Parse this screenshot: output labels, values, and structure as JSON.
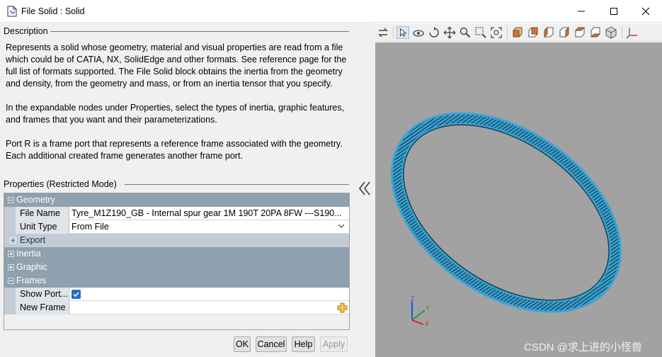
{
  "window": {
    "title": "File Solid : Solid",
    "icon": "document-icon"
  },
  "description": {
    "group_label": "Description",
    "paragraphs": [
      "Represents a solid whose geometry, material and visual properties are read from a file which could be of CATIA, NX, SolidEdge and other formats. See reference page for the full list of formats supported. The File Solid block obtains the inertia from the geometry and density, from the geometry and mass, or from an inertia tensor that you specify.",
      "In the expandable nodes under Properties, select the types of inertia, graphic features, and frames that you want and their parameterizations.",
      "Port R is a frame port that represents a reference frame associated with the geometry. Each additional created frame generates another frame port."
    ]
  },
  "properties": {
    "group_label": "Properties (Restricted Mode)",
    "geometry": {
      "label": "Geometry",
      "file_name_label": "File Name",
      "file_name_value": "Tyre_M1Z190_GB - Internal spur gear 1M 190T 20PA 8FW ---S190...",
      "unit_type_label": "Unit Type",
      "unit_type_value": "From File",
      "export_label": "Export"
    },
    "inertia_label": "Inertia",
    "graphic_label": "Graphic",
    "frames": {
      "label": "Frames",
      "show_port_label": "Show Port...",
      "show_port_checked": true,
      "new_frame_label": "New Frame"
    }
  },
  "buttons": {
    "ok": "OK",
    "cancel": "Cancel",
    "help": "Help",
    "apply": "Apply"
  },
  "viewer": {
    "toolbar_icons": [
      "swap-icon",
      "select-icon",
      "rotate-icon",
      "roll-icon",
      "pan-icon",
      "zoom-icon",
      "zoom-box-icon",
      "fit-to-view-icon",
      "view-front-icon",
      "view-back-icon",
      "view-left-icon",
      "view-right-icon",
      "view-top-icon",
      "view-bottom-icon",
      "view-iso-icon",
      "axes-icon"
    ],
    "background_color": "#a2a2a2",
    "gear_color": "#3aa4d4",
    "axes": {
      "z": "Z",
      "y": "Y",
      "x": "X"
    }
  },
  "watermark": "CSDN @求上进的小怪兽"
}
